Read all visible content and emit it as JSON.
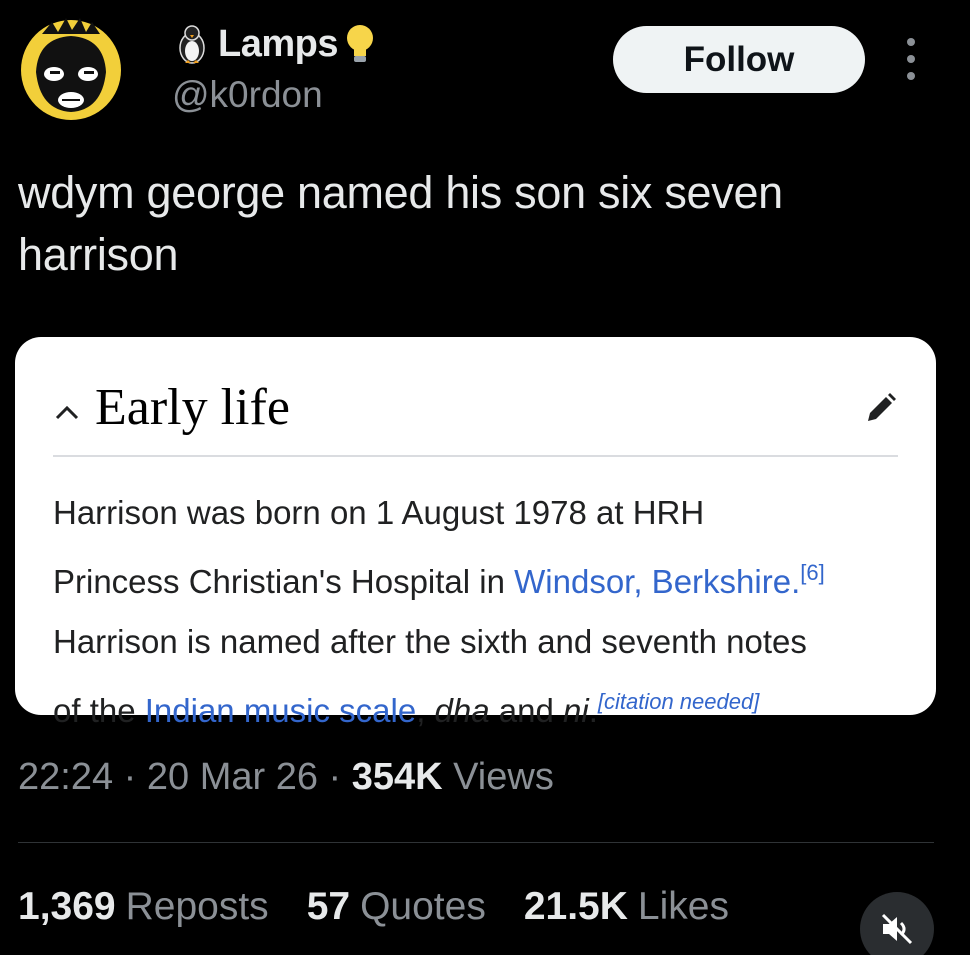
{
  "author": {
    "display_name": "Lamps",
    "handle": "@k0rdon"
  },
  "follow_label": "Follow",
  "tweet": {
    "text": "wdym george named his son six seven harrison"
  },
  "wiki_card": {
    "section_title": "Early life",
    "line1": "Harrison was born on 1 August 1978 at HRH",
    "line2_pre": "Princess Christian's Hospital in ",
    "line2_link": "Windsor, Berkshire.",
    "line2_ref": "[6]",
    "line3": "Harrison is named after the sixth and seventh notes",
    "line4_pre": "of the ",
    "line4_link": "Indian music scale",
    "line4_mid": ", ",
    "line4_em1": "dha",
    "line4_and": " and ",
    "line4_em2": "ni",
    "line4_end": ".",
    "citation": "[citation needed]"
  },
  "meta": {
    "time": "22:24",
    "sep1": " · ",
    "date": "20 Mar 26",
    "sep2": " · ",
    "views_count": "354K",
    "views_label": " Views"
  },
  "stats": {
    "reposts_count": "1,369",
    "reposts_label": "Reposts",
    "quotes_count": "57",
    "quotes_label": "Quotes",
    "likes_count": "21.5K",
    "likes_label": "Likes"
  },
  "colors": {
    "background": "#000000",
    "link": "#3366cc",
    "follow_bg": "#eff3f4",
    "muted_text": "#8b9096"
  },
  "icons": {
    "avatar": "badtz-maru-avatar",
    "name_emoji_1": "penguin-emoji-icon",
    "name_emoji_2": "lightbulb-emoji-icon",
    "edit": "pencil-icon",
    "collapse": "chevron-up-icon",
    "more": "more-vertical-icon",
    "mute": "muted-speaker-icon"
  }
}
